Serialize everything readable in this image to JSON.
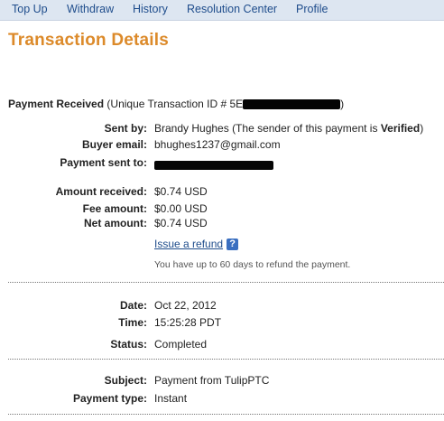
{
  "nav": {
    "items": [
      "Top Up",
      "Withdraw",
      "History",
      "Resolution Center",
      "Profile"
    ]
  },
  "page": {
    "title": "Transaction Details"
  },
  "payment": {
    "heading": "Payment Received",
    "txn_prefix": "(Unique Transaction ID # 5E",
    "txn_suffix": ")",
    "sent_by_label": "Sent by:",
    "sent_by_name": "Brandy Hughes",
    "sent_by_note_prefix": "(The sender of this payment is",
    "sent_by_status": "Verified",
    "sent_by_note_suffix": ")",
    "buyer_email_label": "Buyer email:",
    "buyer_email": "bhughes1237@gmail.com",
    "payment_sent_to_label": "Payment sent to:"
  },
  "amounts": {
    "received_label": "Amount received:",
    "received": "$0.74 USD",
    "fee_label": "Fee amount:",
    "fee": "$0.00 USD",
    "net_label": "Net amount:",
    "net": "$0.74 USD",
    "refund_link": "Issue a refund",
    "help_glyph": "?",
    "refund_note": "You have up to 60 days to refund the payment."
  },
  "details": {
    "date_label": "Date:",
    "date": "Oct 22, 2012",
    "time_label": "Time:",
    "time": "15:25:28 PDT",
    "status_label": "Status:",
    "status": "Completed"
  },
  "extra": {
    "subject_label": "Subject:",
    "subject": "Payment from TulipPTC",
    "type_label": "Payment type:",
    "type": "Instant"
  },
  "icons": {
    "help": "help-icon"
  },
  "colors": {
    "title": "#dc8a2a",
    "link": "#1f4d8c",
    "nav_bg": "#dde6f1",
    "help_bg": "#3a6fc0"
  }
}
